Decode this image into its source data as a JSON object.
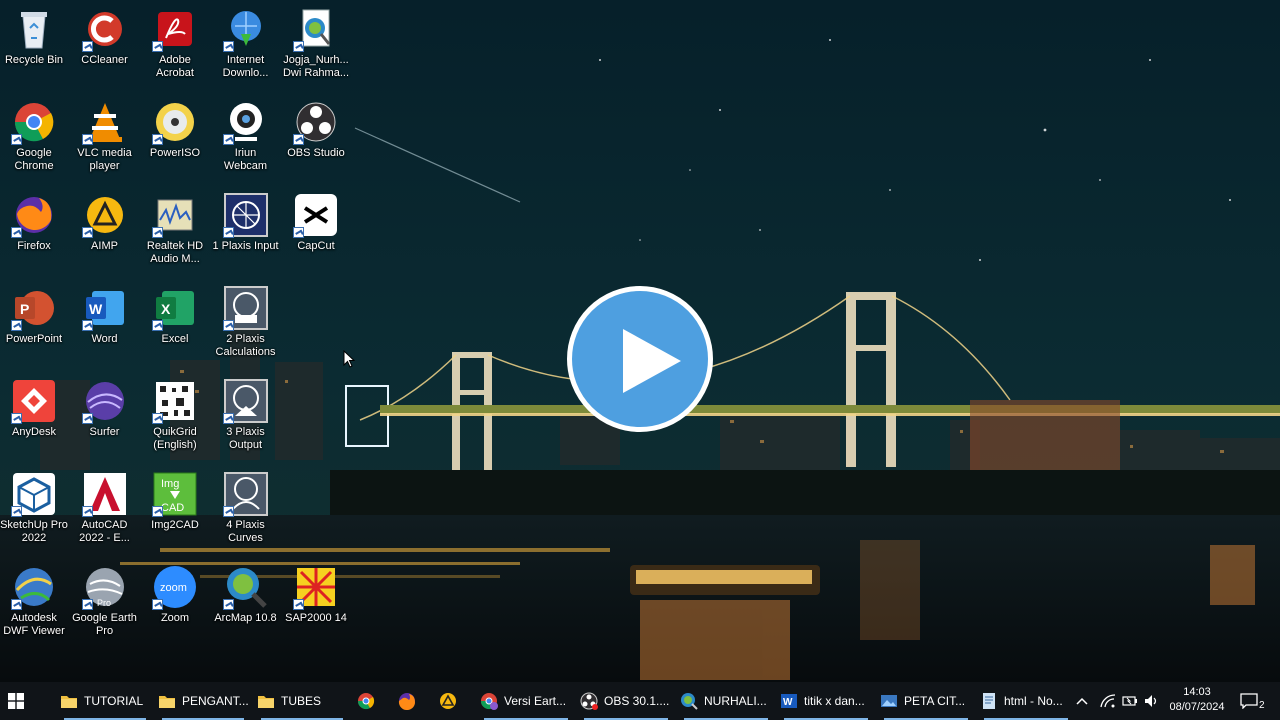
{
  "desktop_icons": [
    {
      "label": "Recycle Bin",
      "icon": "recycle-bin-icon",
      "col": 0,
      "row": 0
    },
    {
      "label": "CCleaner",
      "icon": "ccleaner-icon",
      "col": 1,
      "row": 0
    },
    {
      "label": "Adobe\nAcrobat",
      "icon": "adobe-acrobat-icon",
      "col": 2,
      "row": 0
    },
    {
      "label": "Internet\nDownlo...",
      "icon": "internet-download-manager-icon",
      "col": 3,
      "row": 0
    },
    {
      "label": "Jogja_Nurh...\nDwi Rahma...",
      "icon": "arcmap-document-icon",
      "col": 4,
      "row": 0
    },
    {
      "label": "Google\nChrome",
      "icon": "chrome-icon",
      "col": 0,
      "row": 1
    },
    {
      "label": "VLC media\nplayer",
      "icon": "vlc-icon",
      "col": 1,
      "row": 1
    },
    {
      "label": "PowerISO",
      "icon": "poweriso-icon",
      "col": 2,
      "row": 1
    },
    {
      "label": "Iriun\nWebcam",
      "icon": "iriun-webcam-icon",
      "col": 3,
      "row": 1
    },
    {
      "label": "OBS Studio",
      "icon": "obs-icon",
      "col": 4,
      "row": 1
    },
    {
      "label": "Firefox",
      "icon": "firefox-icon",
      "col": 0,
      "row": 2
    },
    {
      "label": "AIMP",
      "icon": "aimp-icon",
      "col": 1,
      "row": 2
    },
    {
      "label": "Realtek HD\nAudio M...",
      "icon": "realtek-audio-icon",
      "col": 2,
      "row": 2
    },
    {
      "label": "1 Plaxis Input",
      "icon": "plaxis-input-icon",
      "col": 3,
      "row": 2
    },
    {
      "label": "CapCut",
      "icon": "capcut-icon",
      "col": 4,
      "row": 2
    },
    {
      "label": "PowerPoint",
      "icon": "powerpoint-icon",
      "col": 0,
      "row": 3
    },
    {
      "label": "Word",
      "icon": "word-icon",
      "col": 1,
      "row": 3
    },
    {
      "label": "Excel",
      "icon": "excel-icon",
      "col": 2,
      "row": 3
    },
    {
      "label": "2 Plaxis\nCalculations",
      "icon": "plaxis-calculations-icon",
      "col": 3,
      "row": 3
    },
    {
      "label": "AnyDesk",
      "icon": "anydesk-icon",
      "col": 0,
      "row": 4
    },
    {
      "label": "Surfer",
      "icon": "surfer-icon",
      "col": 1,
      "row": 4
    },
    {
      "label": "QuikGrid\n(English)",
      "icon": "quikgrid-icon",
      "col": 2,
      "row": 4
    },
    {
      "label": "3 Plaxis\nOutput",
      "icon": "plaxis-output-icon",
      "col": 3,
      "row": 4
    },
    {
      "label": "SketchUp Pro\n2022",
      "icon": "sketchup-icon",
      "col": 0,
      "row": 5
    },
    {
      "label": "AutoCAD\n2022 - E...",
      "icon": "autocad-icon",
      "col": 1,
      "row": 5
    },
    {
      "label": "Img2CAD",
      "icon": "img2cad-icon",
      "col": 2,
      "row": 5
    },
    {
      "label": "4 Plaxis\nCurves",
      "icon": "plaxis-curves-icon",
      "col": 3,
      "row": 5
    },
    {
      "label": "Autodesk\nDWF Viewer",
      "icon": "dwf-viewer-icon",
      "col": 0,
      "row": 6
    },
    {
      "label": "Google Earth\nPro",
      "icon": "google-earth-icon",
      "col": 1,
      "row": 6
    },
    {
      "label": "Zoom",
      "icon": "zoom-icon",
      "col": 2,
      "row": 6
    },
    {
      "label": "ArcMap 10.8",
      "icon": "arcmap-icon",
      "col": 3,
      "row": 6
    },
    {
      "label": "SAP2000 14",
      "icon": "sap2000-icon",
      "col": 4,
      "row": 6
    }
  ],
  "taskbar": {
    "folders": [
      {
        "label": "TUTORIAL",
        "icon": "folder-icon"
      },
      {
        "label": "PENGANT...",
        "icon": "folder-icon"
      },
      {
        "label": "TUBES",
        "icon": "folder-icon"
      }
    ],
    "pinned": [
      {
        "icon": "chrome-icon"
      },
      {
        "icon": "firefox-icon"
      },
      {
        "icon": "aimp-icon"
      }
    ],
    "windows": [
      {
        "label": "Versi Eart...",
        "icon": "chrome-profile-icon"
      },
      {
        "label": "OBS 30.1....",
        "icon": "obs-icon"
      },
      {
        "label": "NURHALI...",
        "icon": "arcmap-icon"
      },
      {
        "label": "titik x dan...",
        "icon": "word-icon"
      },
      {
        "label": "PETA CIT...",
        "icon": "image-viewer-icon"
      },
      {
        "label": "html - No...",
        "icon": "notepad-icon"
      }
    ],
    "clock_time": "14:03",
    "clock_date": "08/07/2024",
    "notification_count": "2"
  }
}
